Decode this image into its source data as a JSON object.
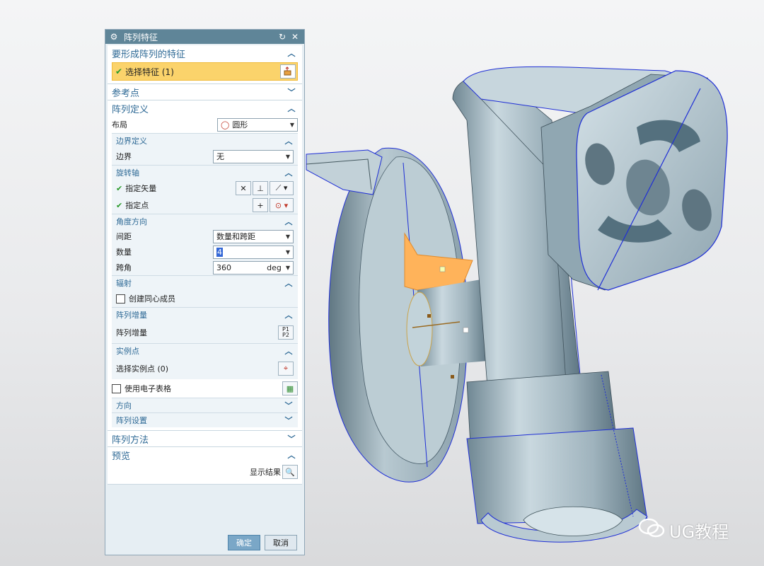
{
  "dialog": {
    "title": "阵列特征",
    "icons": {
      "gear": "gear-icon",
      "reset": "reset-icon",
      "close": "close-icon"
    },
    "sections": {
      "feature": {
        "title": "要形成阵列的特征",
        "select_label": "选择特征 (1)"
      },
      "ref_point": {
        "title": "参考点"
      },
      "array_def": {
        "title": "阵列定义",
        "layout_label": "布局",
        "layout_value": "圆形",
        "boundary": {
          "title": "边界定义",
          "label": "边界",
          "value": "无"
        },
        "rotation_axis": {
          "title": "旋转轴",
          "vector_label": "指定矢量",
          "point_label": "指定点"
        },
        "angle_dir": {
          "title": "角度方向",
          "spacing_label": "间距",
          "spacing_value": "数量和跨距",
          "count_label": "数量",
          "count_value": "4",
          "span_label": "跨角",
          "span_value": "360",
          "span_unit": "deg"
        },
        "radiate": {
          "title": "辐射",
          "checkbox_label": "创建同心成员"
        },
        "increment": {
          "title": "阵列增量",
          "label": "阵列增量"
        },
        "instance": {
          "title": "实例点",
          "label": "选择实例点 (0)"
        },
        "spreadsheet_label": "使用电子表格",
        "direction": {
          "title": "方向"
        },
        "settings": {
          "title": "阵列设置"
        }
      },
      "method": {
        "title": "阵列方法"
      },
      "preview": {
        "title": "预览",
        "show_label": "显示结果"
      }
    },
    "buttons": {
      "ok": "确定",
      "cancel": "取消"
    }
  },
  "watermark": {
    "text": "UG教程"
  },
  "colors": {
    "title_bar": "#5f8598",
    "section_title": "#2f6a96",
    "selected_row": "#fbd36b",
    "model_body": "#aebfc7",
    "model_edge": "#1f2fd6",
    "selection_highlight": "#ffb35a"
  }
}
